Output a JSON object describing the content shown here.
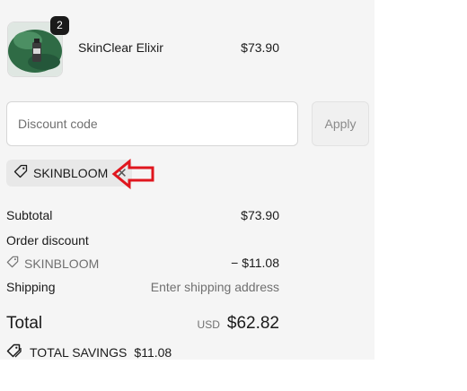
{
  "product": {
    "name": "SkinClear Elixir",
    "price": "$73.90",
    "quantity": "2"
  },
  "discount": {
    "placeholder": "Discount code",
    "apply_label": "Apply",
    "applied_code": "SKINBLOOM"
  },
  "summary": {
    "subtotal_label": "Subtotal",
    "subtotal_value": "$73.90",
    "order_discount_label": "Order discount",
    "discount_code": "SKINBLOOM",
    "discount_value": "− $11.08",
    "shipping_label": "Shipping",
    "shipping_value": "Enter shipping address",
    "total_label": "Total",
    "currency": "USD",
    "total_value": "$62.82",
    "savings_label": "TOTAL SAVINGS",
    "savings_value": "$11.08"
  },
  "colors": {
    "panel_bg": "#f5f5f5",
    "annotation_arrow": "#e0161e"
  }
}
